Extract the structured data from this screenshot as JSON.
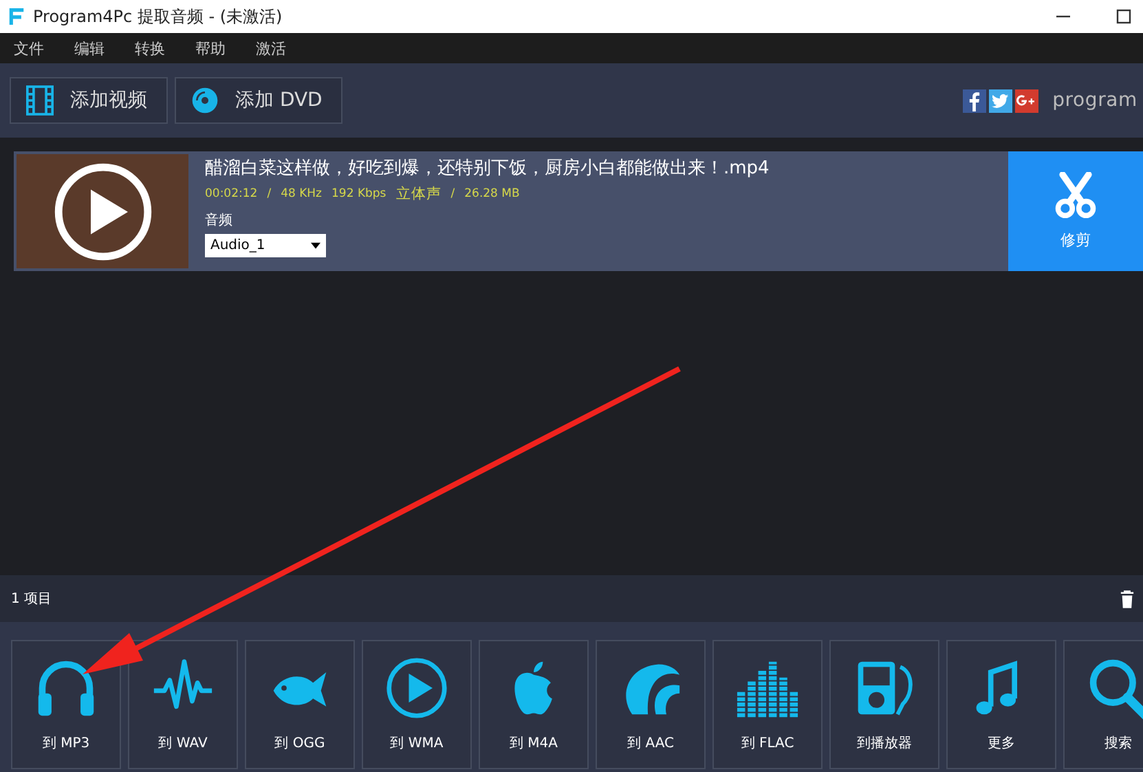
{
  "window": {
    "title": "Program4Pc 提取音频 - (未激活)"
  },
  "menu": [
    "文件",
    "编辑",
    "转换",
    "帮助",
    "激活"
  ],
  "toolbar": [
    {
      "kind": "video",
      "label": "添加视频"
    },
    {
      "kind": "dvd",
      "label": "添加 DVD"
    }
  ],
  "brand": {
    "text": "program"
  },
  "files": [
    {
      "name": "醋溜白菜这样做，好吃到爆，还特别下饭，厨房小白都能做出来！.mp4",
      "duration": "00:02:12",
      "rate": "48 KHz",
      "bitrate": "192 Kbps",
      "channels": "立体声",
      "size": "26.28 MB",
      "separator": "/",
      "audio_label": "音频",
      "audio_track": "Audio_1",
      "trim_label": "修剪"
    }
  ],
  "status": {
    "count": "1 项目"
  },
  "formats": [
    {
      "kind": "headphones",
      "label": "到 MP3"
    },
    {
      "kind": "wave",
      "label": "到 WAV"
    },
    {
      "kind": "fish",
      "label": "到 OGG"
    },
    {
      "kind": "play",
      "label": "到 WMA"
    },
    {
      "kind": "apple",
      "label": "到 M4A"
    },
    {
      "kind": "waves",
      "label": "到 AAC"
    },
    {
      "kind": "bars",
      "label": "到 FLAC"
    },
    {
      "kind": "player",
      "label": "到播放器"
    },
    {
      "kind": "notes",
      "label": "更多"
    },
    {
      "kind": "search",
      "label": "搜索"
    }
  ]
}
